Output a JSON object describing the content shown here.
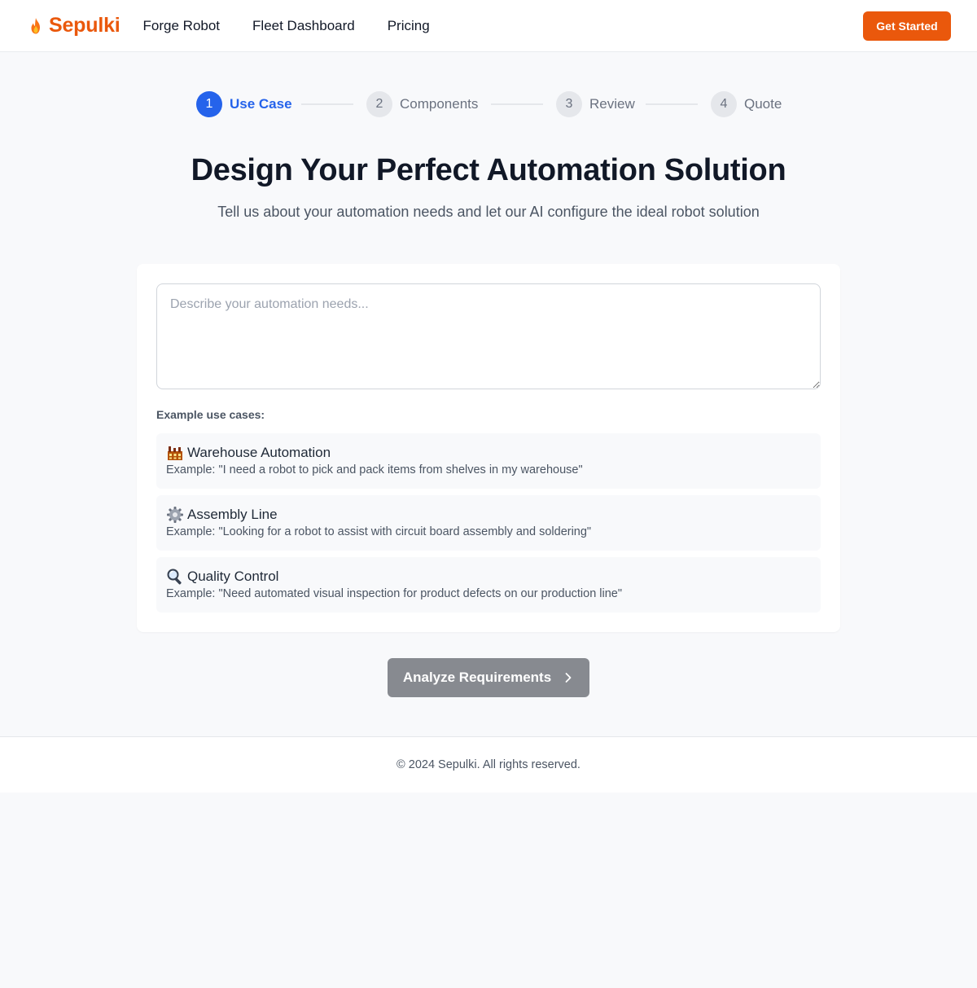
{
  "header": {
    "brand": "Sepulki",
    "brand_icon": "flame-icon",
    "nav": [
      "Forge Robot",
      "Fleet Dashboard",
      "Pricing"
    ],
    "cta": "Get Started"
  },
  "stepper": {
    "steps": [
      {
        "number": "1",
        "label": "Use Case",
        "active": true
      },
      {
        "number": "2",
        "label": "Components",
        "active": false
      },
      {
        "number": "3",
        "label": "Review",
        "active": false
      },
      {
        "number": "4",
        "label": "Quote",
        "active": false
      }
    ]
  },
  "hero": {
    "title": "Design Your Perfect Automation Solution",
    "subtitle": "Tell us about your automation needs and let our AI configure the ideal robot solution"
  },
  "form": {
    "textarea_placeholder": "Describe your automation needs...",
    "textarea_value": "",
    "examples_label": "Example use cases:",
    "examples": [
      {
        "icon": "factory-icon",
        "title": "Warehouse Automation",
        "desc": "Example: \"I need a robot to pick and pack items from shelves in my warehouse\""
      },
      {
        "icon": "gear-icon",
        "title": "Assembly Line",
        "desc": "Example: \"Looking for a robot to assist with circuit board assembly and soldering\""
      },
      {
        "icon": "magnifier-icon",
        "title": "Quality Control",
        "desc": "Example: \"Need automated visual inspection for product defects on our production line\""
      }
    ]
  },
  "actions": {
    "analyze": "Analyze Requirements"
  },
  "footer": {
    "copyright": "© 2024 Sepulki. All rights reserved."
  },
  "colors": {
    "brand": "#ea580c",
    "active_step": "#2563eb",
    "disabled_button": "#878a90"
  }
}
